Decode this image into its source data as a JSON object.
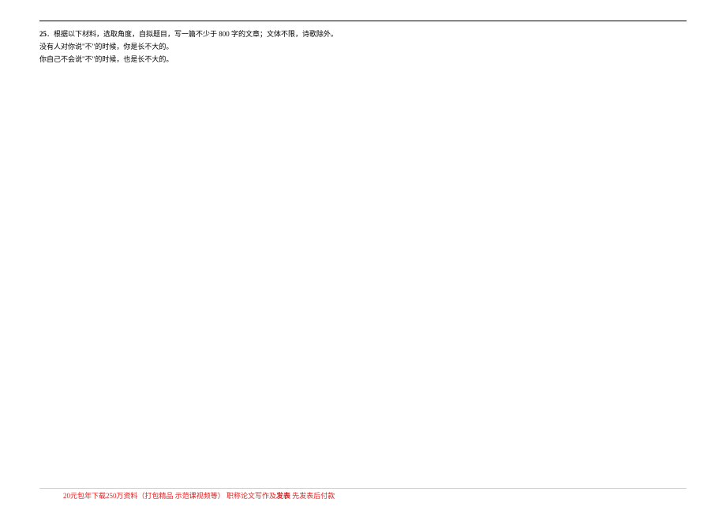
{
  "question": {
    "number": "25",
    "prompt": "．根据以下材料，选取角度，自拟题目，写一篇不少于 800 字的文章；文体不限，诗歌除外。",
    "line2": "没有人对你说\"不\"的时候，你是长不大的。",
    "line3": "你自己不会说\"不\"的时候，也是长不大的。"
  },
  "footer": {
    "part1": "20元包年下载250万资料（打包精品 示范课视频等） 职称论文写作及",
    "part2_bold": "发表",
    "part3": "  先发表后付款"
  }
}
